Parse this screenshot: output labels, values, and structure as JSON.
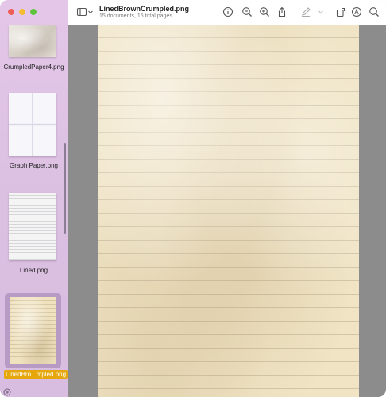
{
  "window": {
    "title": "LinedBrownCrumpled.png",
    "subtitle": "15 documents, 15 total pages"
  },
  "sidebar": {
    "items": [
      {
        "label": "CrumpledPaper4.png"
      },
      {
        "label": "Graph Paper.png"
      },
      {
        "label": "Lined.png"
      },
      {
        "label": "LinedBro...mpled.png",
        "selected": true
      }
    ]
  },
  "toolbar": {
    "icons": [
      "sidebar-toggle-icon",
      "chevron-down-icon",
      "info-icon",
      "zoom-out-icon",
      "zoom-in-icon",
      "share-icon",
      "markup-pen-icon",
      "chevron-down-icon",
      "rotate-icon",
      "annotate-icon",
      "search-icon"
    ]
  },
  "colors": {
    "sidebar_bg": "#e0c4e5",
    "selected_label_bg": "#e5a70c",
    "content_bg": "#8c8c8c",
    "page_bg": "#f0e4c5"
  }
}
